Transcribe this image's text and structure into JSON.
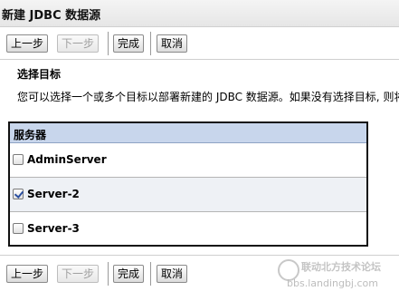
{
  "page": {
    "title": "新建 JDBC 数据源"
  },
  "toolbar": {
    "back_label": "上一步",
    "next_label": "下一步",
    "finish_label": "完成",
    "cancel_label": "取消"
  },
  "section": {
    "heading": "选择目标",
    "description": "您可以选择一个或多个目标以部署新建的 JDBC 数据源。如果没有选择目标, 则将"
  },
  "servers": {
    "header": "服务器",
    "rows": [
      {
        "name": "AdminServer",
        "checked": false
      },
      {
        "name": "Server-2",
        "checked": true
      },
      {
        "name": "Server-3",
        "checked": false
      }
    ]
  },
  "watermark": {
    "line1": "联动北方技术论坛",
    "line2": "bbs.landingbj.com"
  }
}
